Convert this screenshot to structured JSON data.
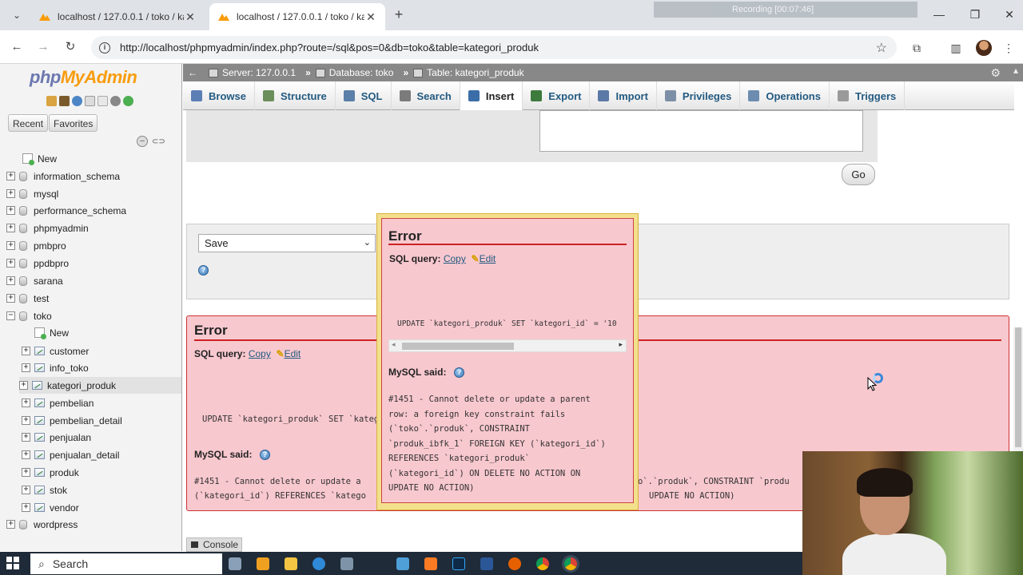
{
  "browser": {
    "tabs": [
      {
        "title": "localhost / 127.0.0.1 / toko / ka"
      },
      {
        "title": "localhost / 127.0.0.1 / toko / ka"
      }
    ],
    "url": "http://localhost/phpmyadmin/index.php?route=/sql&pos=0&db=toko&table=kategori_produk",
    "recording": "Recording [00:07:46]"
  },
  "sidebar": {
    "logo_php": "php",
    "logo_myadmin": "MyAdmin",
    "recent": "Recent",
    "favorites": "Favorites",
    "tree": [
      {
        "label": "New",
        "kind": "new",
        "depth": 1
      },
      {
        "label": "information_schema",
        "kind": "db",
        "depth": 0
      },
      {
        "label": "mysql",
        "kind": "db",
        "depth": 0
      },
      {
        "label": "performance_schema",
        "kind": "db",
        "depth": 0
      },
      {
        "label": "phpmyadmin",
        "kind": "db",
        "depth": 0
      },
      {
        "label": "pmbpro",
        "kind": "db",
        "depth": 0
      },
      {
        "label": "ppdbpro",
        "kind": "db",
        "depth": 0
      },
      {
        "label": "sarana",
        "kind": "db",
        "depth": 0
      },
      {
        "label": "test",
        "kind": "db",
        "depth": 0
      },
      {
        "label": "toko",
        "kind": "db-open",
        "depth": 0
      },
      {
        "label": "New",
        "kind": "new",
        "depth": 2
      },
      {
        "label": "customer",
        "kind": "table",
        "depth": 2
      },
      {
        "label": "info_toko",
        "kind": "table",
        "depth": 2
      },
      {
        "label": "kategori_produk",
        "kind": "table",
        "depth": 2,
        "selected": true
      },
      {
        "label": "pembelian",
        "kind": "table",
        "depth": 2
      },
      {
        "label": "pembelian_detail",
        "kind": "table",
        "depth": 2
      },
      {
        "label": "penjualan",
        "kind": "table",
        "depth": 2
      },
      {
        "label": "penjualan_detail",
        "kind": "table",
        "depth": 2
      },
      {
        "label": "produk",
        "kind": "table",
        "depth": 2
      },
      {
        "label": "stok",
        "kind": "table",
        "depth": 2
      },
      {
        "label": "vendor",
        "kind": "table",
        "depth": 2
      },
      {
        "label": "wordpress",
        "kind": "db",
        "depth": 0
      }
    ]
  },
  "breadcrumb": {
    "server": "Server: 127.0.0.1",
    "database": "Database: toko",
    "table": "Table: kategori_produk"
  },
  "tabs": [
    {
      "label": "Browse",
      "icon": "browse-icon"
    },
    {
      "label": "Structure",
      "icon": "structure-icon"
    },
    {
      "label": "SQL",
      "icon": "sql-icon"
    },
    {
      "label": "Search",
      "icon": "search-icon"
    },
    {
      "label": "Insert",
      "icon": "insert-icon",
      "active": true
    },
    {
      "label": "Export",
      "icon": "export-icon"
    },
    {
      "label": "Import",
      "icon": "import-icon"
    },
    {
      "label": "Privileges",
      "icon": "privileges-icon"
    },
    {
      "label": "Operations",
      "icon": "operations-icon"
    },
    {
      "label": "Triggers",
      "icon": "triggers-icon"
    }
  ],
  "form": {
    "go": "Go",
    "save_select": "Save"
  },
  "error_bg": {
    "title": "Error",
    "sql_query": "SQL query:",
    "copy": "Copy",
    "edit": "Edit",
    "query": "UPDATE `kategori_produk` SET `kategor",
    "mysql_said": "MySQL said:",
    "msg_line1_left": "#1451 - Cannot delete or update a",
    "msg_line1_right": "o`.`produk`, CONSTRAINT `produ",
    "msg_line2_left": "(`kategori_id`) REFERENCES `katego",
    "msg_line2_right": "UPDATE NO ACTION)"
  },
  "error_modal": {
    "title": "Error",
    "sql_query": "SQL query:",
    "copy": "Copy",
    "edit": "Edit",
    "query": "UPDATE `kategori_produk` SET `kategori_id` = '10",
    "mysql_said": "MySQL said:",
    "message": [
      "#1451 - Cannot delete or update a parent",
      "row: a foreign key constraint fails",
      "(`toko`.`produk`, CONSTRAINT",
      "`produk_ibfk_1` FOREIGN KEY (`kategori_id`)",
      "REFERENCES `kategori_produk`",
      "(`kategori_id`) ON DELETE NO ACTION ON",
      "UPDATE NO ACTION)"
    ]
  },
  "console": "Console",
  "taskbar": {
    "search": "Search"
  },
  "colors": {
    "error_bg": "#f8c8cf",
    "error_line": "#cc2222",
    "link": "#235a81",
    "modal_border": "#f3e08d"
  }
}
